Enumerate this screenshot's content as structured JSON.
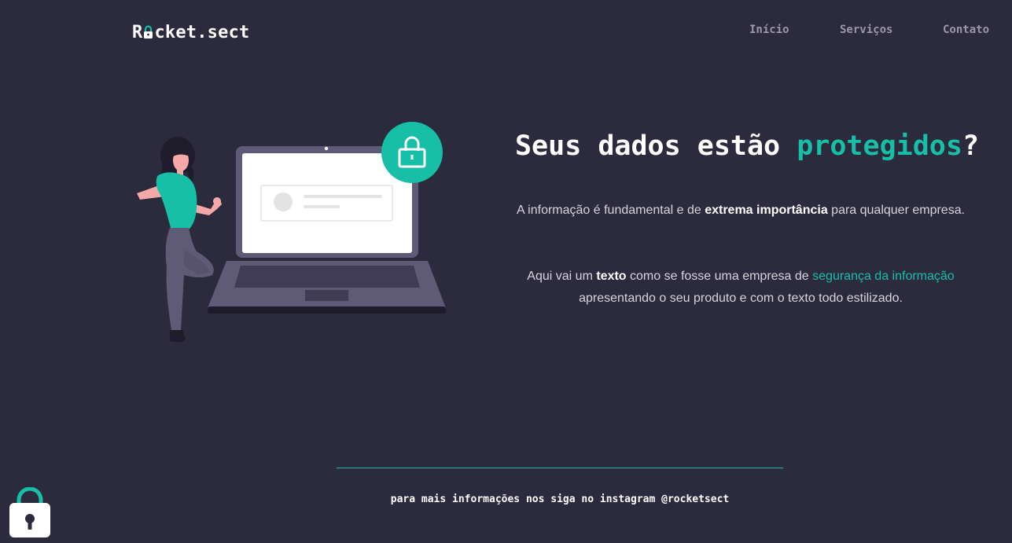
{
  "header": {
    "logo_prefix": "R",
    "logo_suffix": "cket.sect",
    "nav": [
      "Início",
      "Serviços",
      "Contato"
    ]
  },
  "hero": {
    "headline_plain": "Seus dados estão ",
    "headline_accent": "protegidos",
    "headline_end": "?",
    "p1": {
      "before": "A informação é fundamental e de ",
      "bold": "extrema importância",
      "after": " para qualquer empresa."
    },
    "p2": {
      "before": "Aqui vai um ",
      "bold": "texto",
      "middle": " como se fosse uma empresa de ",
      "link": "segurança da informação",
      "after": " apresentando o seu produto e com o texto todo estilizado."
    }
  },
  "footer": {
    "text": "para mais informações nos siga no instagram @rocketsect"
  },
  "colors": {
    "background": "#2c2a3d",
    "accent": "#16bfa6",
    "text": "#ffffff",
    "muted": "#9a98a8"
  },
  "icons": {
    "logo_o": "padlock-icon",
    "floating": "padlock-icon",
    "illustration_badge": "padlock-icon"
  }
}
